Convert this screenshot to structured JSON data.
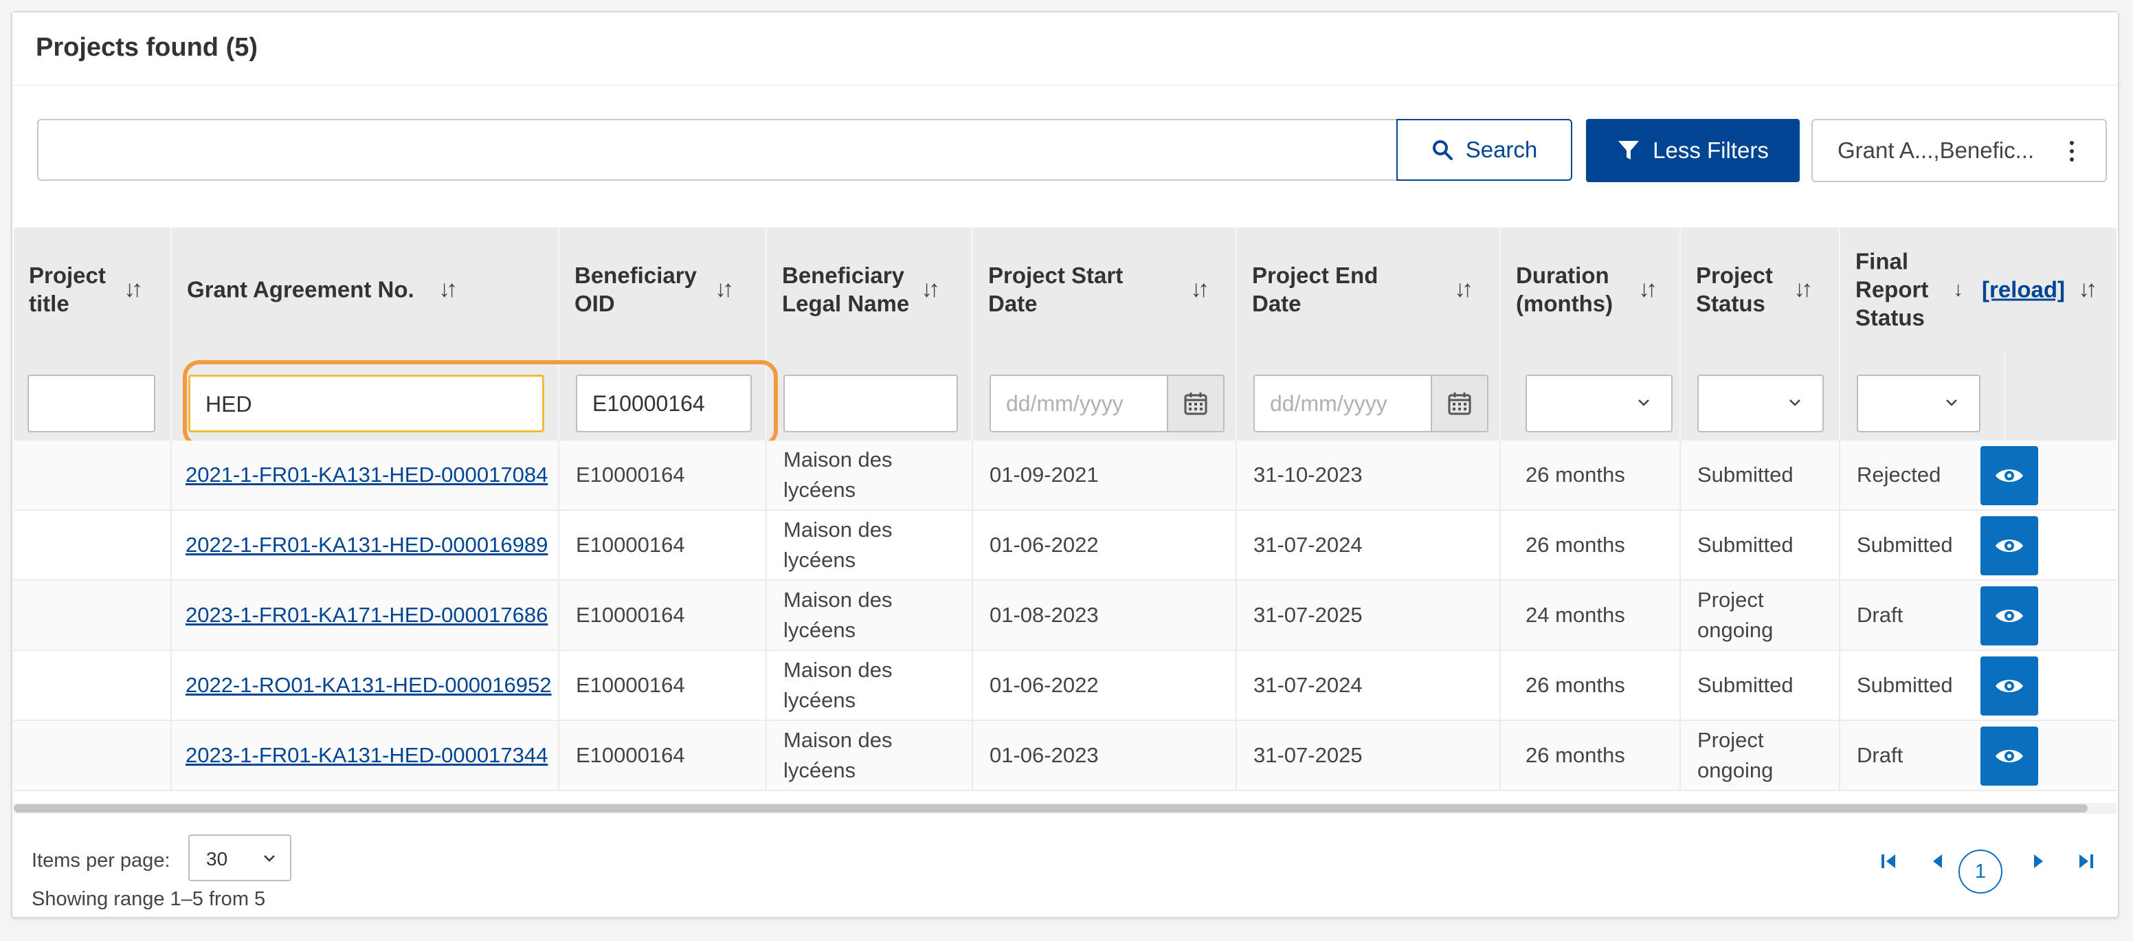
{
  "header": {
    "title": "Projects found (5)"
  },
  "toolbar": {
    "search_value": "",
    "search_label": "Search",
    "filters_label": "Less Filters",
    "columns_label": "Grant A...,Benefic..."
  },
  "columns": [
    {
      "label": "Project title"
    },
    {
      "label": "Grant Agreement No."
    },
    {
      "label": "Beneficiary OID"
    },
    {
      "label": "Beneficiary Legal Name"
    },
    {
      "label": "Project Start Date"
    },
    {
      "label": "Project End Date"
    },
    {
      "label": "Duration (months)"
    },
    {
      "label": "Project Status"
    },
    {
      "label": "Final Report Status"
    }
  ],
  "reload_label": "[reload]",
  "filters": {
    "project_title": "",
    "grant_agreement": "HED",
    "beneficiary_oid": "E10000164",
    "legal_name": "",
    "start_date_placeholder": "dd/mm/yyyy",
    "end_date_placeholder": "dd/mm/yyyy",
    "duration": "",
    "project_status": "",
    "final_report_status": ""
  },
  "rows": [
    {
      "title": "",
      "grant": "2021-1-FR01-KA131-HED-000017084",
      "oid": "E10000164",
      "name_1": "Maison des",
      "name_2": "lycéens",
      "start": "01-09-2021",
      "end": "31-10-2023",
      "duration": "26 months",
      "status_1": "Submitted",
      "status_2": "",
      "report": "Rejected"
    },
    {
      "title": "",
      "grant": "2022-1-FR01-KA131-HED-000016989",
      "oid": "E10000164",
      "name_1": "Maison des",
      "name_2": "lycéens",
      "start": "01-06-2022",
      "end": "31-07-2024",
      "duration": "26 months",
      "status_1": "Submitted",
      "status_2": "",
      "report": "Submitted"
    },
    {
      "title": "",
      "grant": "2023-1-FR01-KA171-HED-000017686",
      "oid": "E10000164",
      "name_1": "Maison des",
      "name_2": "lycéens",
      "start": "01-08-2023",
      "end": "31-07-2025",
      "duration": "24 months",
      "status_1": "Project",
      "status_2": "ongoing",
      "report": "Draft"
    },
    {
      "title": "",
      "grant": "2022-1-RO01-KA131-HED-000016952",
      "oid": "E10000164",
      "name_1": "Maison des",
      "name_2": "lycéens",
      "start": "01-06-2022",
      "end": "31-07-2024",
      "duration": "26 months",
      "status_1": "Submitted",
      "status_2": "",
      "report": "Submitted"
    },
    {
      "title": "",
      "grant": "2023-1-FR01-KA131-HED-000017344",
      "oid": "E10000164",
      "name_1": "Maison des",
      "name_2": "lycéens",
      "start": "01-06-2023",
      "end": "31-07-2025",
      "duration": "26 months",
      "status_1": "Project",
      "status_2": "ongoing",
      "report": "Draft"
    }
  ],
  "footer": {
    "items_per_page_label": "Items per page:",
    "items_per_page_value": "30",
    "range_text": "Showing range 1–5 from 5",
    "current_page": "1"
  },
  "colors": {
    "primary": "#004494",
    "eye_button": "#0b6fbf",
    "highlight": "#f29b3c",
    "active_input": "#f2bb3d"
  }
}
